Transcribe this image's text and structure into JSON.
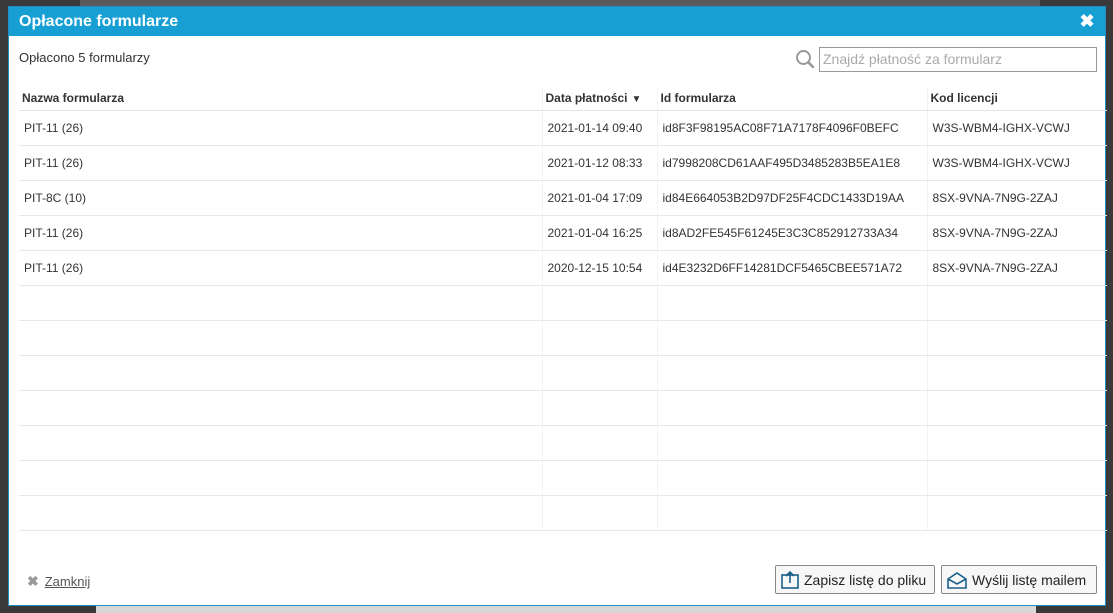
{
  "dialog": {
    "title": "Opłacone formularze",
    "summary": "Opłacono 5 formularzy"
  },
  "search": {
    "placeholder": "Znajdź płatność za formularz",
    "value": ""
  },
  "table": {
    "columns": {
      "name": "Nazwa formularza",
      "date": "Data płatności",
      "date_sort": "▼",
      "id": "Id formularza",
      "license": "Kod licencji"
    },
    "rows": [
      {
        "name": "PIT-11 (26)",
        "date": "2021-01-14 09:40",
        "id": "id8F3F98195AC08F71A7178F4096F0BEFC",
        "license": "W3S-WBM4-IGHX-VCWJ"
      },
      {
        "name": "PIT-11 (26)",
        "date": "2021-01-12 08:33",
        "id": "id7998208CD61AAF495D3485283B5EA1E8",
        "license": "W3S-WBM4-IGHX-VCWJ"
      },
      {
        "name": "PIT-8C (10)",
        "date": "2021-01-04 17:09",
        "id": "id84E664053B2D97DF25F4CDC1433D19AA",
        "license": "8SX-9VNA-7N9G-2ZAJ"
      },
      {
        "name": "PIT-11 (26)",
        "date": "2021-01-04 16:25",
        "id": "id8AD2FE545F61245E3C3C852912733A34",
        "license": "8SX-9VNA-7N9G-2ZAJ"
      },
      {
        "name": "PIT-11 (26)",
        "date": "2020-12-15 10:54",
        "id": "id4E3232D6FF14281DCF5465CBEE571A72",
        "license": "8SX-9VNA-7N9G-2ZAJ"
      }
    ]
  },
  "footer": {
    "close_label": "Zamknij",
    "save_label": "Zapisz listę do pliku",
    "mail_label": "Wyślij listę mailem"
  },
  "colors": {
    "title_bar": "#179fd4",
    "accent": "#1e8fc0"
  }
}
